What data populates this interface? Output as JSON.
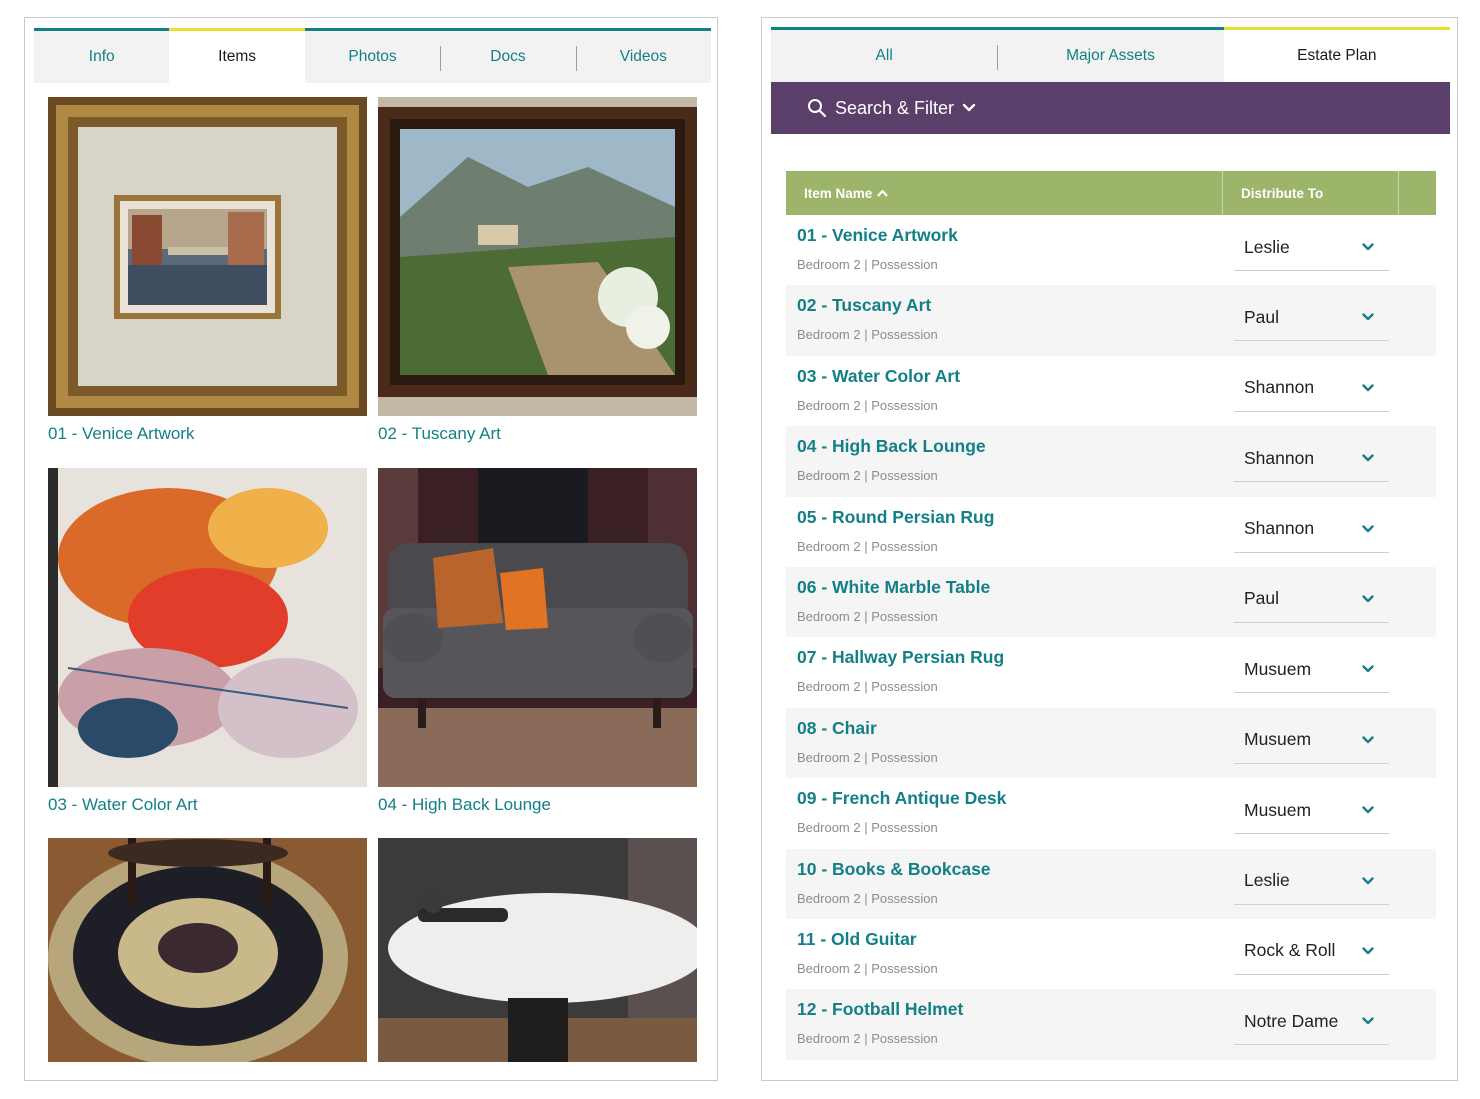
{
  "left": {
    "tabs": [
      {
        "label": "Info",
        "active": false
      },
      {
        "label": "Items",
        "active": true
      },
      {
        "label": "Photos",
        "active": false
      },
      {
        "label": "Docs",
        "active": false
      },
      {
        "label": "Videos",
        "active": false
      }
    ],
    "cards": [
      {
        "caption": "01 - Venice Artwork"
      },
      {
        "caption": "02 - Tuscany Art"
      },
      {
        "caption": "03 - Water Color Art"
      },
      {
        "caption": "04 - High Back Lounge"
      },
      {
        "caption": ""
      },
      {
        "caption": ""
      }
    ]
  },
  "right": {
    "tabs": [
      {
        "label": "All",
        "active": false
      },
      {
        "label": "Major Assets",
        "active": false
      },
      {
        "label": "Estate Plan",
        "active": true
      }
    ],
    "filter": {
      "label": "Search & Filter",
      "icon": "search-icon"
    },
    "table": {
      "col_name": "Item Name",
      "col_distribute": "Distribute To",
      "rows": [
        {
          "name": "01 - Venice Artwork",
          "meta": "Bedroom 2 | Possession",
          "distribute": "Leslie"
        },
        {
          "name": "02 - Tuscany Art",
          "meta": "Bedroom 2 | Possession",
          "distribute": "Paul"
        },
        {
          "name": "03 - Water Color Art",
          "meta": "Bedroom 2 | Possession",
          "distribute": "Shannon"
        },
        {
          "name": "04 - High Back Lounge",
          "meta": "Bedroom 2 | Possession",
          "distribute": "Shannon"
        },
        {
          "name": "05 - Round Persian Rug",
          "meta": "Bedroom 2 | Possession",
          "distribute": "Shannon"
        },
        {
          "name": "06 - White Marble Table",
          "meta": "Bedroom 2 | Possession",
          "distribute": "Paul"
        },
        {
          "name": "07 - Hallway Persian Rug",
          "meta": "Bedroom 2 | Possession",
          "distribute": "Musuem"
        },
        {
          "name": "08 - Chair",
          "meta": "Bedroom 2 | Possession",
          "distribute": "Musuem"
        },
        {
          "name": "09 - French Antique Desk",
          "meta": "Bedroom 2 | Possession",
          "distribute": "Musuem"
        },
        {
          "name": "10 - Books & Bookcase",
          "meta": "Bedroom 2 | Possession",
          "distribute": "Leslie"
        },
        {
          "name": "11 - Old Guitar",
          "meta": "Bedroom 2 | Possession",
          "distribute": "Rock & Roll"
        },
        {
          "name": "12 - Football Helmet",
          "meta": "Bedroom 2 | Possession",
          "distribute": "Notre Dame"
        }
      ]
    }
  },
  "colors": {
    "teal": "#137f86",
    "active_tab_accent": "#e8df34",
    "filter_bar": "#5b3f6b",
    "table_header": "#9db46b"
  }
}
